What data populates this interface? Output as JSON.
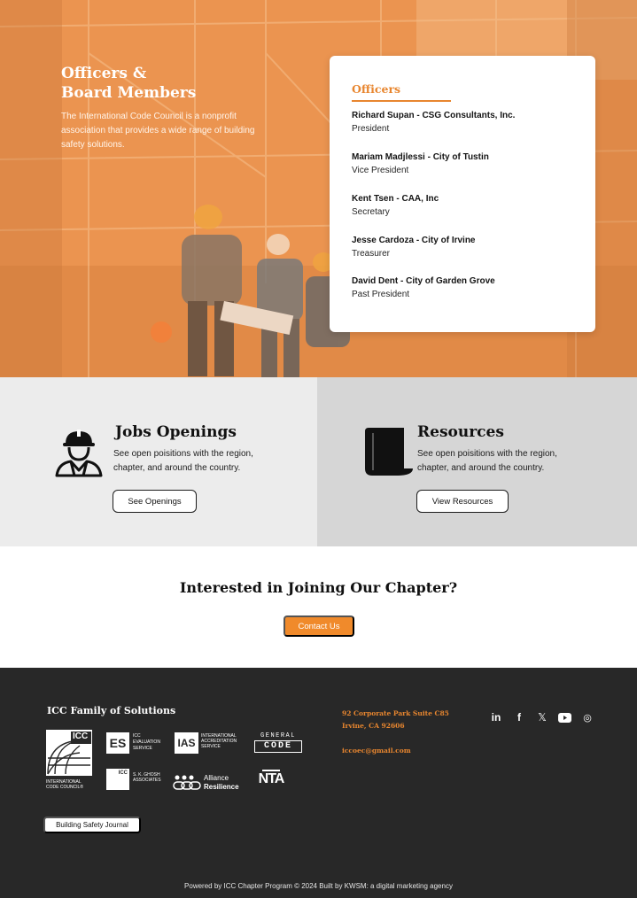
{
  "hero": {
    "title_line1": "Officers &",
    "title_line2": "Board Members",
    "description": "The International Code Council is a nonprofit association that provides a wide range of building safety solutions."
  },
  "officers": {
    "heading": "Officers",
    "list": [
      {
        "name": "Richard Supan - CSG Consultants, Inc.",
        "role": "President"
      },
      {
        "name": "Mariam Madjlessi - City of Tustin",
        "role": "Vice President"
      },
      {
        "name": "Kent Tsen - CAA, Inc",
        "role": "Secretary"
      },
      {
        "name": "Jesse Cardoza - City of Irvine",
        "role": "Treasurer"
      },
      {
        "name": "David Dent - City of Garden Grove",
        "role": "Past President"
      }
    ]
  },
  "jobs": {
    "title": "Jobs Openings",
    "description": "See open poisitions with the region, chapter, and around the country.",
    "button": "See Openings",
    "icon": "construction-worker-icon"
  },
  "resources": {
    "title": "Resources",
    "description": "See open poisitions with the region, chapter, and around the country.",
    "button": "View Resources",
    "icon": "document-scroll-icon"
  },
  "join": {
    "title": "Interested in Joining Our Chapter?",
    "button": "Contact Us"
  },
  "footer": {
    "heading": "ICC Family of Solutions",
    "logos": {
      "icc": {
        "mark": "ICC",
        "line1": "INTERNATIONAL",
        "line2": "CODE COUNCIL®"
      },
      "es": {
        "mark": "ES",
        "text1": "ICC",
        "text2": "EVALUATION",
        "text3": "SERVICE"
      },
      "ias": {
        "mark": "IAS",
        "text1": "INTERNATIONAL",
        "text2": "ACCREDITATION",
        "text3": "SERVICE"
      },
      "general_code": {
        "line1": "GENERAL",
        "line2": "CODE"
      },
      "skghosh": {
        "mark": "ICC",
        "text1": "S. K. GHOSH",
        "text2": "ASSOCIATES"
      },
      "alliance": {
        "line1": "Alliance",
        "line2": "Resilience"
      },
      "nta": {
        "mark": "NTA"
      }
    },
    "bsj_button": "Building Safety Journal",
    "address_line1": "92 Corporate Park Suite C85",
    "address_line2": "Irvine, CA 92606",
    "email": "iccoec@gmail.com",
    "social": [
      "linkedin-icon",
      "facebook-icon",
      "x-icon",
      "youtube-icon",
      "instagram-icon"
    ],
    "social_glyphs": {
      "linkedin": "in",
      "facebook": "f",
      "x": "𝕏",
      "instagram": "◎"
    },
    "credit": "Powered by ICC Chapter Program © 2024  Built by KWSM: a digital marketing agency"
  },
  "colors": {
    "accent": "#e8862f",
    "footer_bg": "#282828",
    "panel_left": "#ececec",
    "panel_right": "#d6d6d6"
  }
}
